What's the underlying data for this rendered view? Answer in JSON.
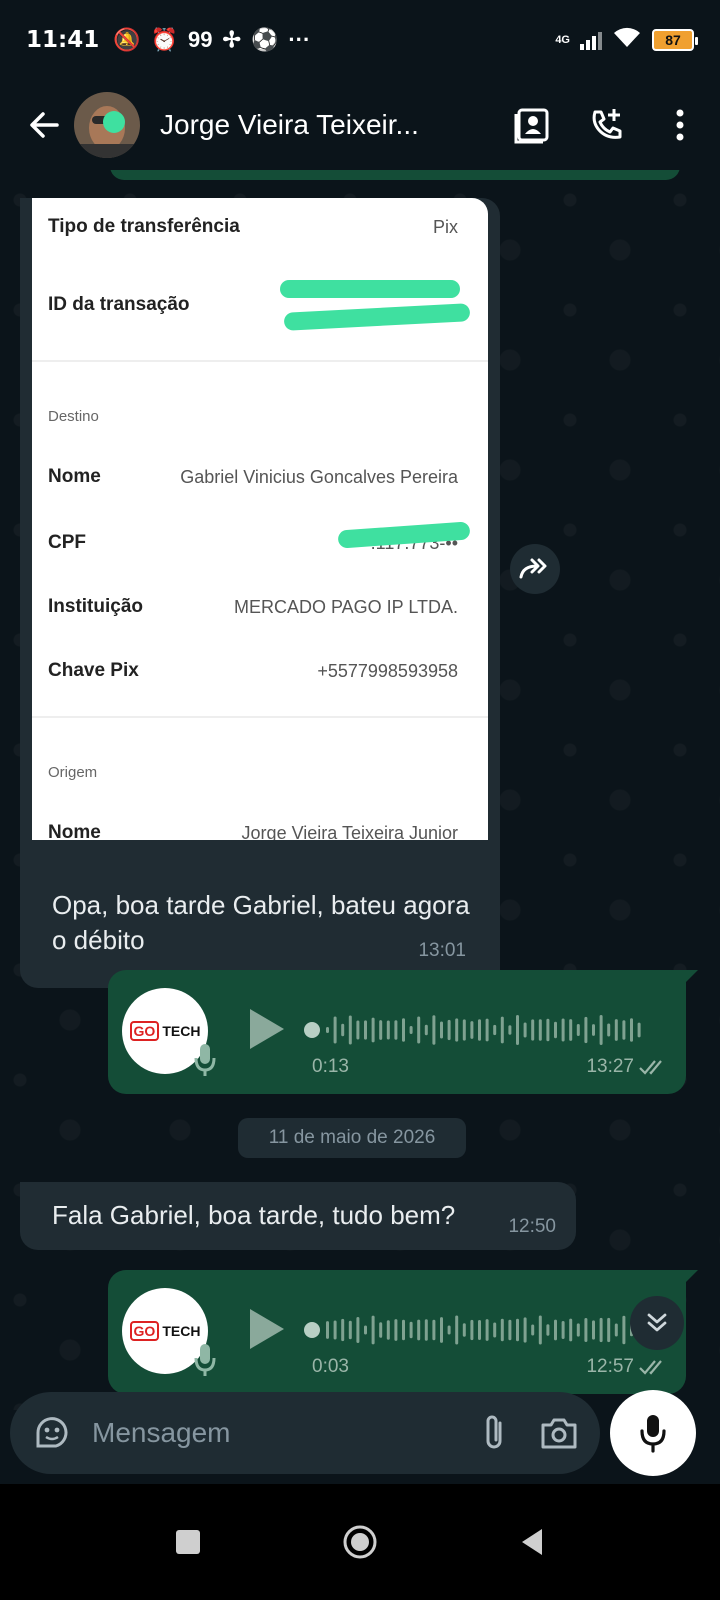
{
  "status_bar": {
    "time": "11:41",
    "notif_count": "99",
    "network": "4G",
    "battery": "87"
  },
  "header": {
    "contact_name": "Jorge Vieira Teixeir..."
  },
  "receipt": {
    "rows_top": [
      {
        "label": "Tipo de transferência",
        "value": "Pix"
      },
      {
        "label": "ID da transação",
        "value": ""
      }
    ],
    "destino_title": "Destino",
    "destino_rows": [
      {
        "label": "Nome",
        "value": "Gabriel Vinicius Goncalves Pereira"
      },
      {
        "label": "CPF",
        "value": "•••.117.773-••"
      },
      {
        "label": "Instituição",
        "value": "MERCADO PAGO IP LTDA."
      },
      {
        "label": "Chave Pix",
        "value": "+5577998593958"
      }
    ],
    "origem_title": "Origem",
    "origem_rows": [
      {
        "label": "Nome",
        "value": "Jorge Vieira Teixeira Junior"
      }
    ]
  },
  "messages": {
    "caption": "Opa, boa tarde Gabriel, bateu agora o débito",
    "caption_time": "13:01",
    "voice1": {
      "duration": "0:13",
      "time": "13:27"
    },
    "date_chip": "11 de maio de 2026",
    "text1": "Fala Gabriel, boa tarde, tudo bem?",
    "text1_time": "12:50",
    "voice2": {
      "duration": "0:03",
      "time": "12:57"
    },
    "avatar_logo_text": "TECH",
    "avatar_logo_go": "GO"
  },
  "composer": {
    "placeholder": "Mensagem"
  },
  "colors": {
    "background": "#0b141a",
    "incoming": "#202c33",
    "outgoing": "#144d37",
    "redaction": "#3fe0a0"
  }
}
